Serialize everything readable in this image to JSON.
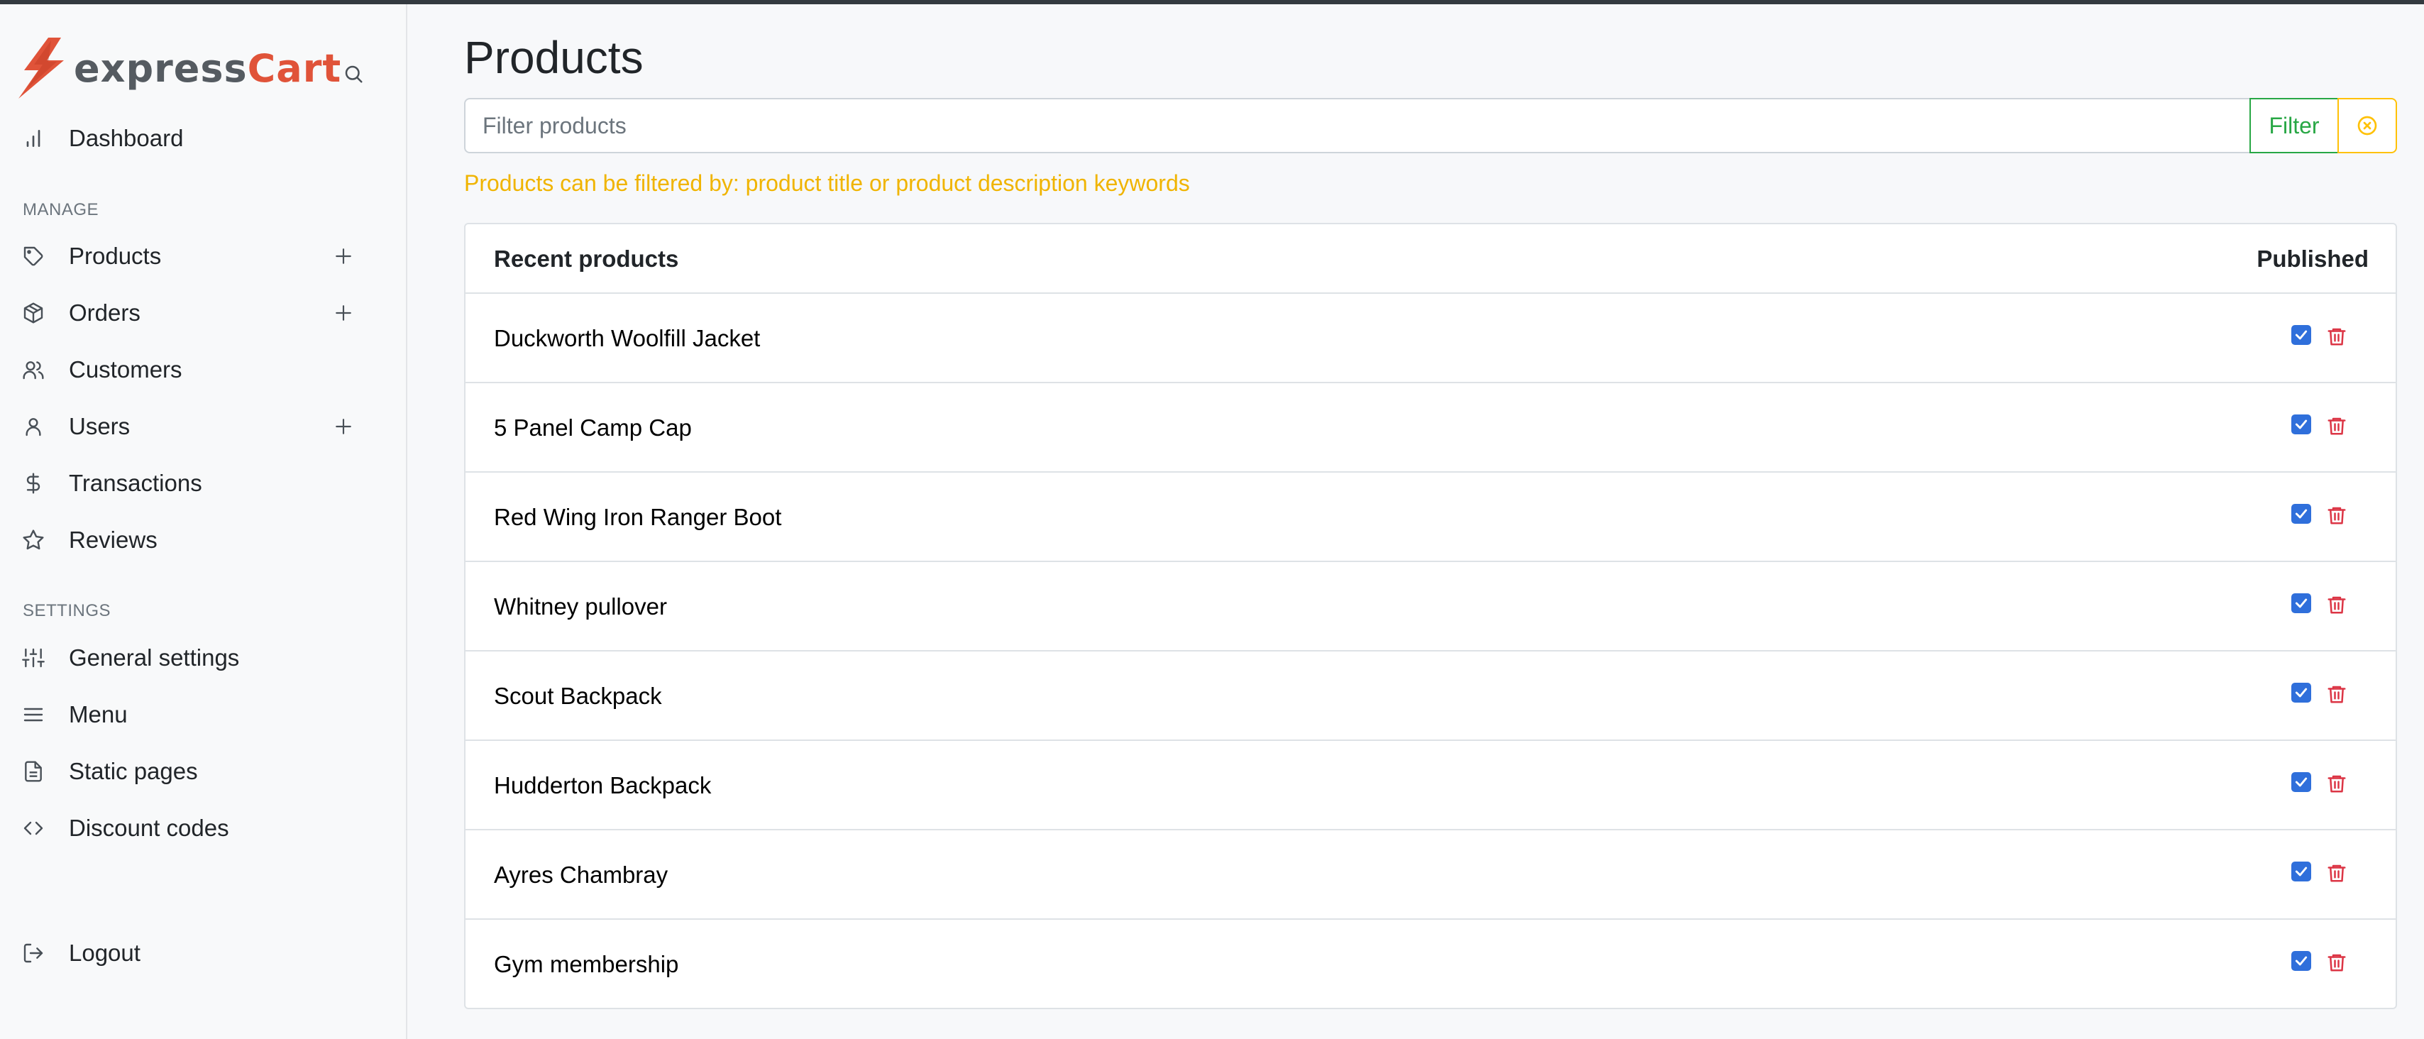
{
  "brand": {
    "part1": "express",
    "part2": "Cart"
  },
  "sidebar": {
    "dashboard": {
      "label": "Dashboard"
    },
    "manage_heading": "MANAGE",
    "manage_items": [
      {
        "label": "Products",
        "icon": "tag-icon",
        "has_add": true
      },
      {
        "label": "Orders",
        "icon": "package-icon",
        "has_add": true
      },
      {
        "label": "Customers",
        "icon": "users-icon",
        "has_add": false
      },
      {
        "label": "Users",
        "icon": "user-icon",
        "has_add": true
      },
      {
        "label": "Transactions",
        "icon": "dollar-icon",
        "has_add": false
      },
      {
        "label": "Reviews",
        "icon": "star-icon",
        "has_add": false
      }
    ],
    "settings_heading": "SETTINGS",
    "settings_items": [
      {
        "label": "General settings",
        "icon": "sliders-icon"
      },
      {
        "label": "Menu",
        "icon": "menu-icon"
      },
      {
        "label": "Static pages",
        "icon": "file-icon"
      },
      {
        "label": "Discount codes",
        "icon": "code-icon"
      }
    ],
    "logout": {
      "label": "Logout",
      "icon": "logout-icon"
    }
  },
  "main": {
    "title": "Products",
    "filter": {
      "placeholder": "Filter products",
      "value": "",
      "button_label": "Filter"
    },
    "hint": "Products can be filtered by: product title or product description keywords",
    "table": {
      "header_left": "Recent products",
      "header_right": "Published",
      "rows": [
        {
          "title": "Duckworth Woolfill Jacket",
          "published": true
        },
        {
          "title": "5 Panel Camp Cap",
          "published": true
        },
        {
          "title": "Red Wing Iron Ranger Boot",
          "published": true
        },
        {
          "title": "Whitney pullover",
          "published": true
        },
        {
          "title": "Scout Backpack",
          "published": true
        },
        {
          "title": "Hudderton Backpack",
          "published": true
        },
        {
          "title": "Ayres Chambray",
          "published": true
        },
        {
          "title": "Gym membership",
          "published": true
        }
      ]
    }
  },
  "colors": {
    "brand_red": "#e05339",
    "filter_green": "#28a745",
    "warning_yellow": "#ffc107",
    "hint_yellow": "#f0b400",
    "checkbox_blue": "#2f6fdb",
    "delete_red": "#dc3545"
  }
}
